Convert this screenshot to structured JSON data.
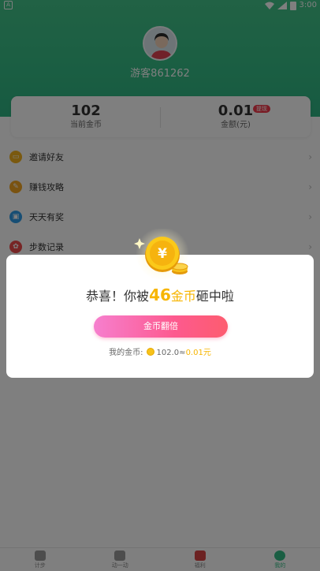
{
  "status": {
    "icon_text": "A",
    "time": "3:00"
  },
  "profile": {
    "username": "游客861262"
  },
  "coins": {
    "current_value": "102",
    "current_label": "当前金币",
    "balance_value": "0.01",
    "balance_label": "金额(元)",
    "withdraw_tag": "提现"
  },
  "menu": {
    "items": [
      {
        "label": "邀请好友",
        "icon": "invite-icon",
        "color": "#f5b21e"
      },
      {
        "label": "赚钱攻略",
        "icon": "guide-icon",
        "color": "#f5a622"
      },
      {
        "label": "天天有奖",
        "icon": "prize-icon",
        "color": "#2f9de8"
      },
      {
        "label": "步数记录",
        "icon": "steps-icon",
        "color": "#ef4b4b"
      }
    ]
  },
  "nav": {
    "items": [
      {
        "label": "计步"
      },
      {
        "label": "动一动"
      },
      {
        "label": "福利"
      },
      {
        "label": "我的"
      }
    ]
  },
  "dialog": {
    "title_prefix": "恭喜！你被",
    "coin_amount": "46",
    "coin_unit": "金币",
    "title_suffix": "砸中啦",
    "double_button": "金币翻倍",
    "my_coins_label": "我的金币:",
    "my_coins_value": "102.0",
    "equals": "≈",
    "yuan_value": "0.01元"
  },
  "colors": {
    "brand": "#35bd86",
    "accent": "#f7b500",
    "button_start": "#f67fce",
    "button_end": "#fd5c6f"
  }
}
